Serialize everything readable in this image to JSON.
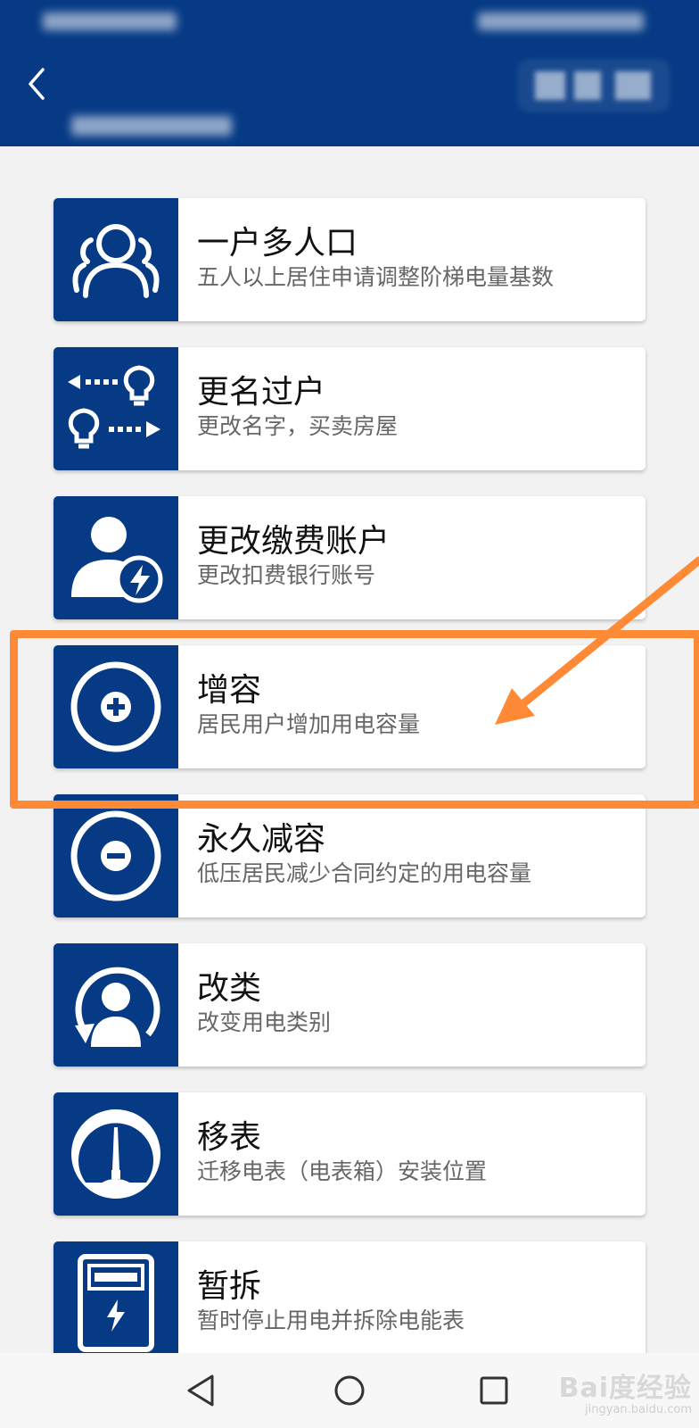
{
  "colors": {
    "header_bg": "#063a85",
    "icon_bg": "#063a85",
    "annotation": "#ff8a36",
    "page_bg": "#f2f2f2"
  },
  "header": {
    "back_icon": "chevron-left-icon"
  },
  "services": [
    {
      "title": "一户多人口",
      "desc": "五人以上居住申请调整阶梯电量基数",
      "icon": "people-group-icon"
    },
    {
      "title": "更名过户",
      "desc": "更改名字，买卖房屋",
      "icon": "bulb-transfer-icon"
    },
    {
      "title": "更改缴费账户",
      "desc": "更改扣费银行账号",
      "icon": "user-lightning-icon"
    },
    {
      "title": "增容",
      "desc": "居民用户增加用电容量",
      "icon": "plus-circle-icon"
    },
    {
      "title": "永久减容",
      "desc": "低压居民减少合同约定的用电容量",
      "icon": "minus-circle-icon"
    },
    {
      "title": "改类",
      "desc": "改变用电类别",
      "icon": "user-rotate-icon"
    },
    {
      "title": "移表",
      "desc": "迁移电表（电表箱）安装位置",
      "icon": "gauge-icon"
    },
    {
      "title": "暂拆",
      "desc": "暂时停止用电并拆除电能表",
      "icon": "meter-box-icon"
    }
  ],
  "bottom_nav": {
    "back": "triangle-back-icon",
    "home": "circle-home-icon",
    "recent": "square-recent-icon"
  },
  "watermark": {
    "main": "Bai度经验",
    "sub": "jingyan.baidu.com"
  }
}
